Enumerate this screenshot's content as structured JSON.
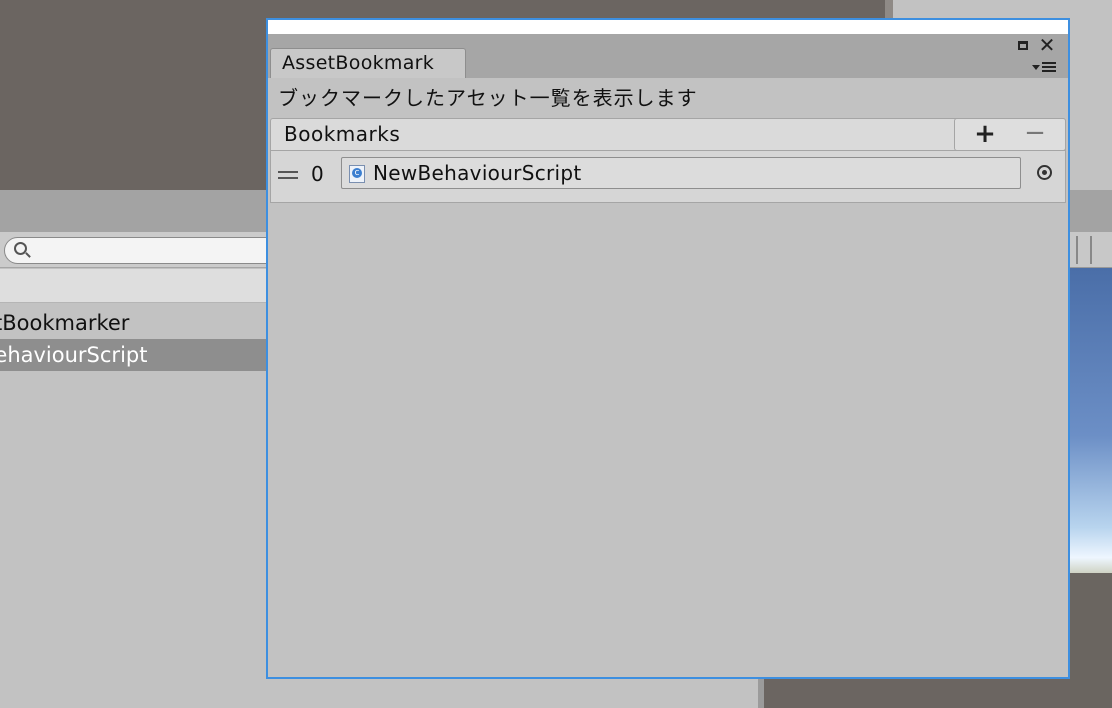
{
  "project_panel": {
    "items": [
      {
        "label": "tBookmarker",
        "selected": false
      },
      {
        "label": "BehaviourScript",
        "selected": true
      }
    ]
  },
  "window": {
    "tab_title": "AssetBookmark",
    "description": "ブックマークしたアセット一覧を表示します",
    "list_header": "Bookmarks",
    "add_label": "+",
    "remove_label": "−",
    "entries": [
      {
        "index": "0",
        "asset_name": "NewBehaviourScript",
        "icon": "csharp-script-icon"
      }
    ]
  },
  "colors": {
    "window_border": "#3d8fe0",
    "panel_bg": "#c2c2c2",
    "selection_bg": "#8e8e8e"
  }
}
